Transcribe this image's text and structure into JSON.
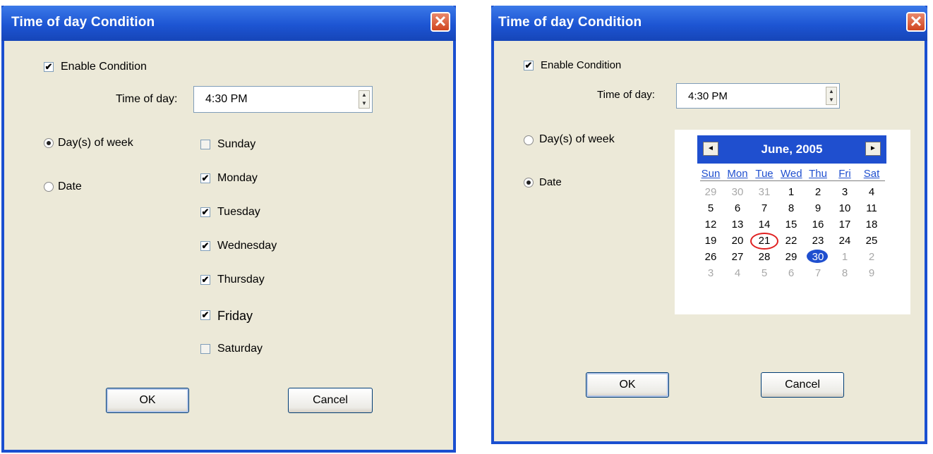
{
  "dialogs": [
    {
      "title": "Time of day Condition",
      "enable_label": "Enable Condition",
      "enable_checked": true,
      "time_label": "Time of day:",
      "time_value": "4:30 PM",
      "mode_days_label": "Day(s) of week",
      "mode_date_label": "Date",
      "selected_mode": "days",
      "days": [
        {
          "label": "Sunday",
          "checked": false
        },
        {
          "label": "Monday",
          "checked": true
        },
        {
          "label": "Tuesday",
          "checked": true
        },
        {
          "label": "Wednesday",
          "checked": true
        },
        {
          "label": "Thursday",
          "checked": true
        },
        {
          "label": "Friday",
          "checked": true
        },
        {
          "label": "Saturday",
          "checked": false
        }
      ],
      "ok_label": "OK",
      "cancel_label": "Cancel"
    },
    {
      "title": "Time of day Condition",
      "enable_label": "Enable Condition",
      "enable_checked": true,
      "time_label": "Time of day:",
      "time_value": "4:30 PM",
      "mode_days_label": "Day(s) of week",
      "mode_date_label": "Date",
      "selected_mode": "date",
      "calendar": {
        "month_label": "June, 2005",
        "prev_icon": "◄",
        "next_icon": "►",
        "weekdays": [
          "Sun",
          "Mon",
          "Tue",
          "Wed",
          "Thu",
          "Fri",
          "Sat"
        ],
        "weeks": [
          [
            {
              "d": "29",
              "other": true
            },
            {
              "d": "30",
              "other": true
            },
            {
              "d": "31",
              "other": true
            },
            {
              "d": "1"
            },
            {
              "d": "2"
            },
            {
              "d": "3"
            },
            {
              "d": "4"
            }
          ],
          [
            {
              "d": "5"
            },
            {
              "d": "6"
            },
            {
              "d": "7"
            },
            {
              "d": "8"
            },
            {
              "d": "9"
            },
            {
              "d": "10"
            },
            {
              "d": "11"
            }
          ],
          [
            {
              "d": "12"
            },
            {
              "d": "13"
            },
            {
              "d": "14"
            },
            {
              "d": "15"
            },
            {
              "d": "16"
            },
            {
              "d": "17"
            },
            {
              "d": "18"
            }
          ],
          [
            {
              "d": "19"
            },
            {
              "d": "20"
            },
            {
              "d": "21",
              "today": true
            },
            {
              "d": "22"
            },
            {
              "d": "23"
            },
            {
              "d": "24"
            },
            {
              "d": "25"
            }
          ],
          [
            {
              "d": "26"
            },
            {
              "d": "27"
            },
            {
              "d": "28"
            },
            {
              "d": "29"
            },
            {
              "d": "30",
              "selected": true
            },
            {
              "d": "1",
              "other": true
            },
            {
              "d": "2",
              "other": true
            }
          ],
          [
            {
              "d": "3",
              "other": true
            },
            {
              "d": "4",
              "other": true
            },
            {
              "d": "5",
              "other": true
            },
            {
              "d": "6",
              "other": true
            },
            {
              "d": "7",
              "other": true
            },
            {
              "d": "8",
              "other": true
            },
            {
              "d": "9",
              "other": true
            }
          ]
        ]
      },
      "ok_label": "OK",
      "cancel_label": "Cancel"
    }
  ],
  "icons": {
    "close": "close-icon",
    "check": "✔",
    "spin_up": "▲",
    "spin_down": "▼"
  },
  "colors": {
    "titlebar": "#1d55d3",
    "dialog_bg": "#ece9d8",
    "calendar_header": "#1f4fcf",
    "today_ring": "#e02020"
  }
}
